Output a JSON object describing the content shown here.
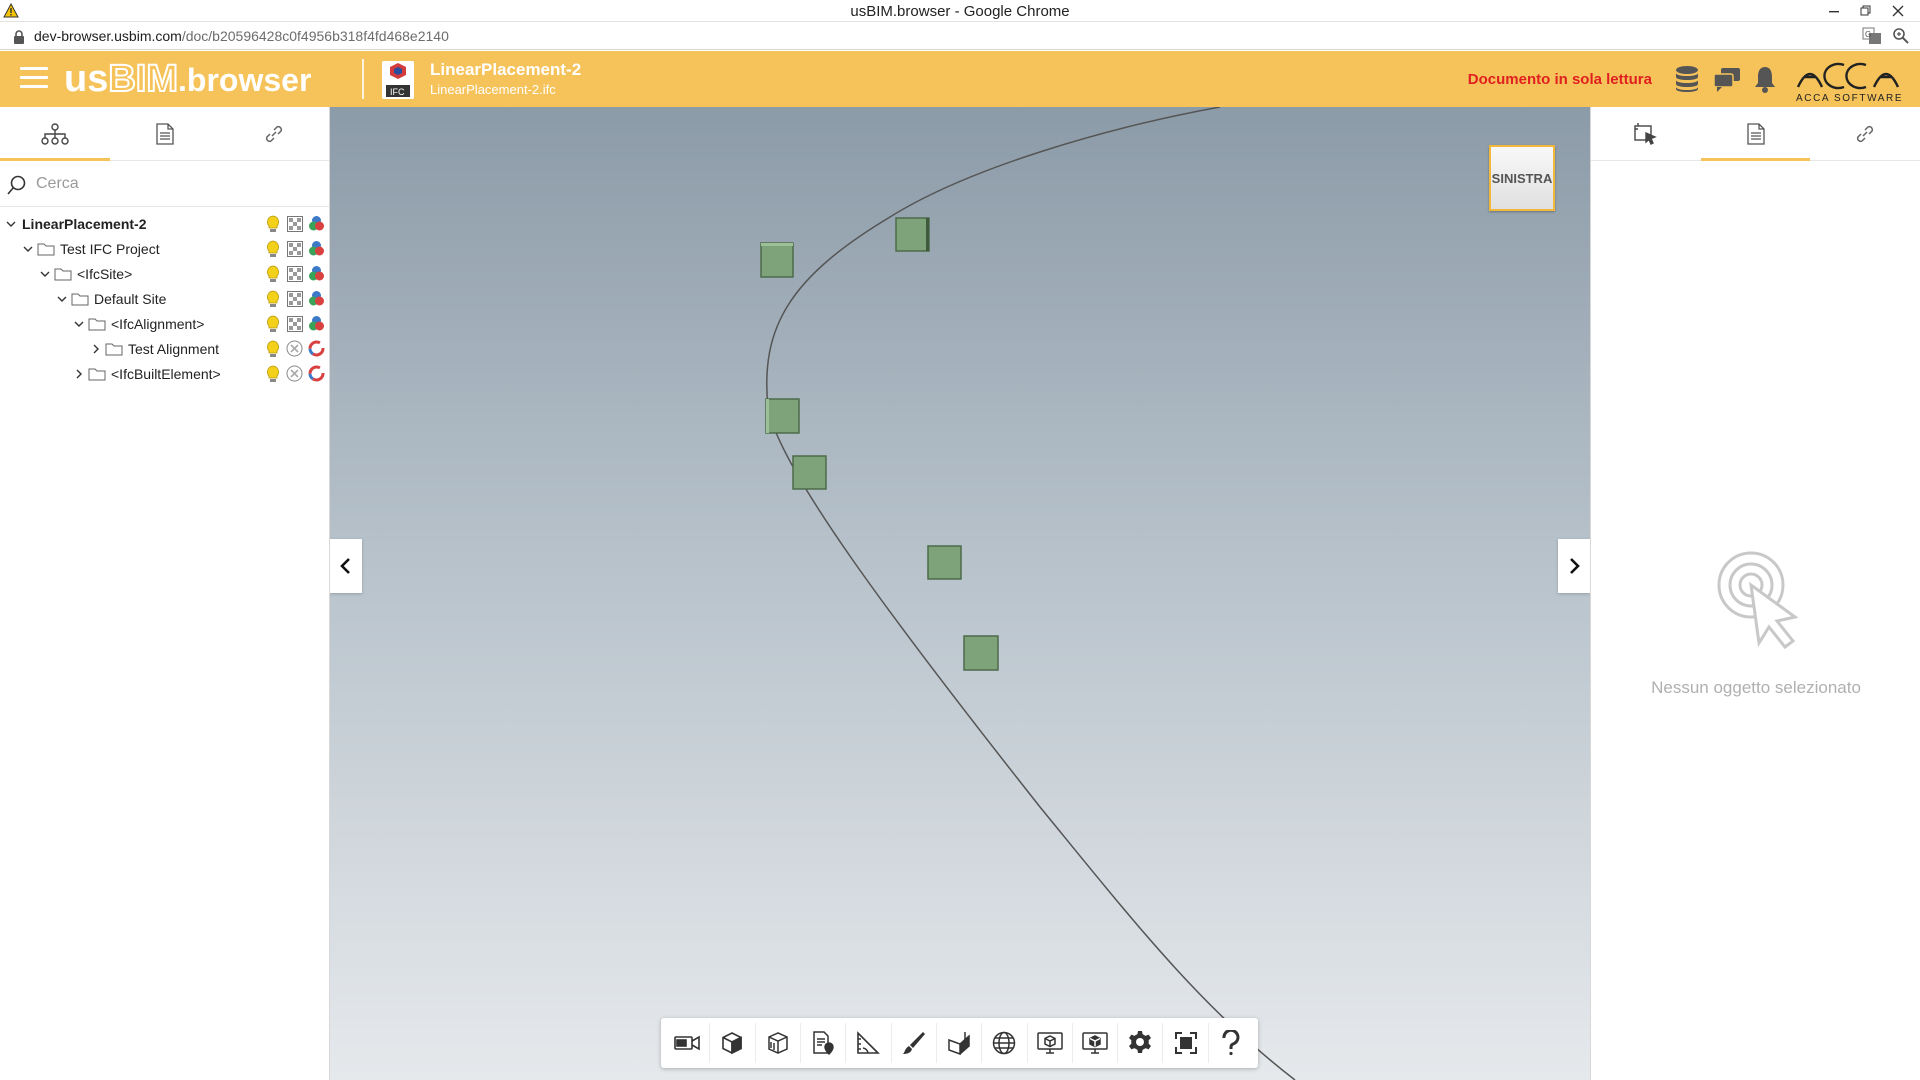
{
  "browser": {
    "window_title": "usBIM.browser - Google Chrome",
    "url_host": "dev-browser.usbim.com",
    "url_path": "/doc/b20596428c0f4956b318f4fd468e2140"
  },
  "header": {
    "brand_us": "us",
    "brand_bim": "BIM",
    "brand_rest": ".browser",
    "document_title": "LinearPlacement-2",
    "document_file": "LinearPlacement-2.ifc",
    "file_type_badge": "IFC",
    "readonly_notice": "Documento in sola lettura",
    "readonly_color": "#e02020",
    "accent_color": "#f5c35a",
    "logo_text": "ACCA",
    "logo_sub": "ACCA SOFTWARE",
    "icons": [
      "database-icon",
      "chat-icon",
      "bell-icon"
    ]
  },
  "left_panel": {
    "tabs": [
      "hierarchy-tree-icon",
      "document-icon",
      "link-icon"
    ],
    "active_tab": 0,
    "search_placeholder": "Cerca",
    "tree": [
      {
        "label": "LinearPlacement-2",
        "level": 0,
        "expanded": true,
        "folder": false,
        "bold": true,
        "visibility": "bulb",
        "ghost": "checker",
        "color": "rgb-dots"
      },
      {
        "label": "Test IFC Project",
        "level": 1,
        "expanded": true,
        "folder": true,
        "bold": false,
        "visibility": "bulb",
        "ghost": "checker",
        "color": "rgb-dots"
      },
      {
        "label": "<IfcSite>",
        "level": 2,
        "expanded": true,
        "folder": true,
        "bold": false,
        "visibility": "bulb",
        "ghost": "checker",
        "color": "rgb-dots"
      },
      {
        "label": "Default Site",
        "level": 3,
        "expanded": true,
        "folder": true,
        "bold": false,
        "visibility": "bulb",
        "ghost": "checker",
        "color": "rgb-dots"
      },
      {
        "label": "<IfcAlignment>",
        "level": 4,
        "expanded": true,
        "folder": true,
        "bold": false,
        "visibility": "bulb",
        "ghost": "checker",
        "color": "rgb-dots"
      },
      {
        "label": "Test Alignment",
        "level": 5,
        "expanded": false,
        "folder": true,
        "bold": false,
        "visibility": "bulb",
        "ghost": "circle-x",
        "color": "ring"
      },
      {
        "label": "<IfcBuiltElement>",
        "level": 4,
        "expanded": false,
        "folder": true,
        "bold": false,
        "visibility": "bulb",
        "ghost": "circle-x",
        "color": "ring"
      }
    ]
  },
  "viewport": {
    "nav_cube_label": "SINISTRA",
    "toolbar": [
      "camera-icon",
      "cube-view-icon",
      "box-section-icon",
      "document-pin-icon",
      "measure-angle-icon",
      "brush-icon",
      "section-plane-icon",
      "globe-icon",
      "monitor-cube-icon",
      "monitor-3d-icon",
      "settings-gear-icon",
      "fit-screen-icon",
      "help-icon"
    ]
  },
  "right_panel": {
    "tabs": [
      "select-object-icon",
      "document-icon",
      "link-icon"
    ],
    "active_tab": 1,
    "empty_message": "Nessun oggetto selezionato"
  }
}
